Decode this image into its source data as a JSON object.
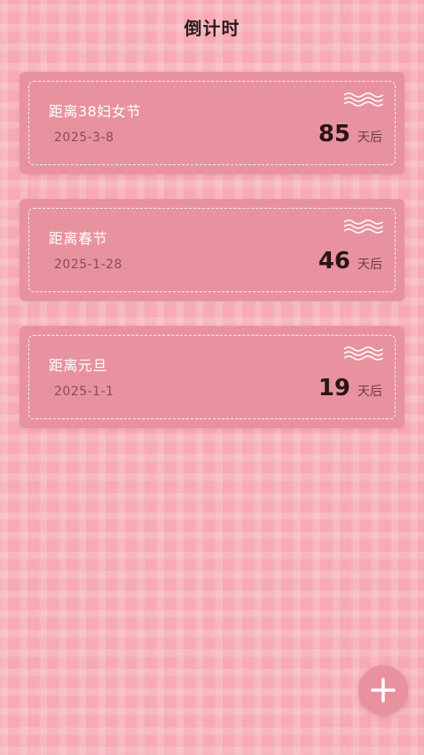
{
  "header": {
    "title": "倒计时"
  },
  "countdowns": [
    {
      "name": "距离38妇女节",
      "date": "2025-3-8",
      "days": "85",
      "unit": "天后"
    },
    {
      "name": "距离春节",
      "date": "2025-1-28",
      "days": "46",
      "unit": "天后"
    },
    {
      "name": "距离元旦",
      "date": "2025-1-1",
      "days": "19",
      "unit": "天后"
    }
  ],
  "add_button": {
    "icon": "plus-icon"
  },
  "colors": {
    "background": "#f7aab4",
    "card": "#e8929f",
    "count_text": "#2a1416",
    "name_text": "#ffffff"
  }
}
